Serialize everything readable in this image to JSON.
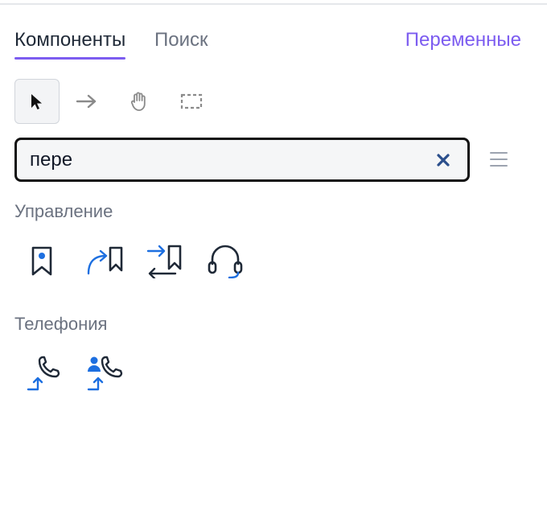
{
  "tabs": {
    "components": "Компоненты",
    "search": "Поиск",
    "variables": "Переменные"
  },
  "toolbar": {
    "tools": [
      {
        "icon": "cursor-arrow-icon",
        "active": true
      },
      {
        "icon": "arrow-right-icon",
        "active": false
      },
      {
        "icon": "hand-icon",
        "active": false
      },
      {
        "icon": "dashed-rectangle-icon",
        "active": false
      }
    ]
  },
  "search": {
    "value": "пере",
    "placeholder": ""
  },
  "sections": [
    {
      "title": "Управление",
      "items": [
        "bookmark-marker-icon",
        "redirect-bookmark-icon",
        "swap-bookmark-icon",
        "headset-icon"
      ]
    },
    {
      "title": "Телефония",
      "items": [
        "call-transfer-icon",
        "contact-call-transfer-icon"
      ]
    }
  ],
  "colors": {
    "accent": "#7c5cf0",
    "icon_dark": "#1f2937",
    "icon_blue": "#1d6fe0",
    "clear_icon": "#2b4f8c"
  }
}
